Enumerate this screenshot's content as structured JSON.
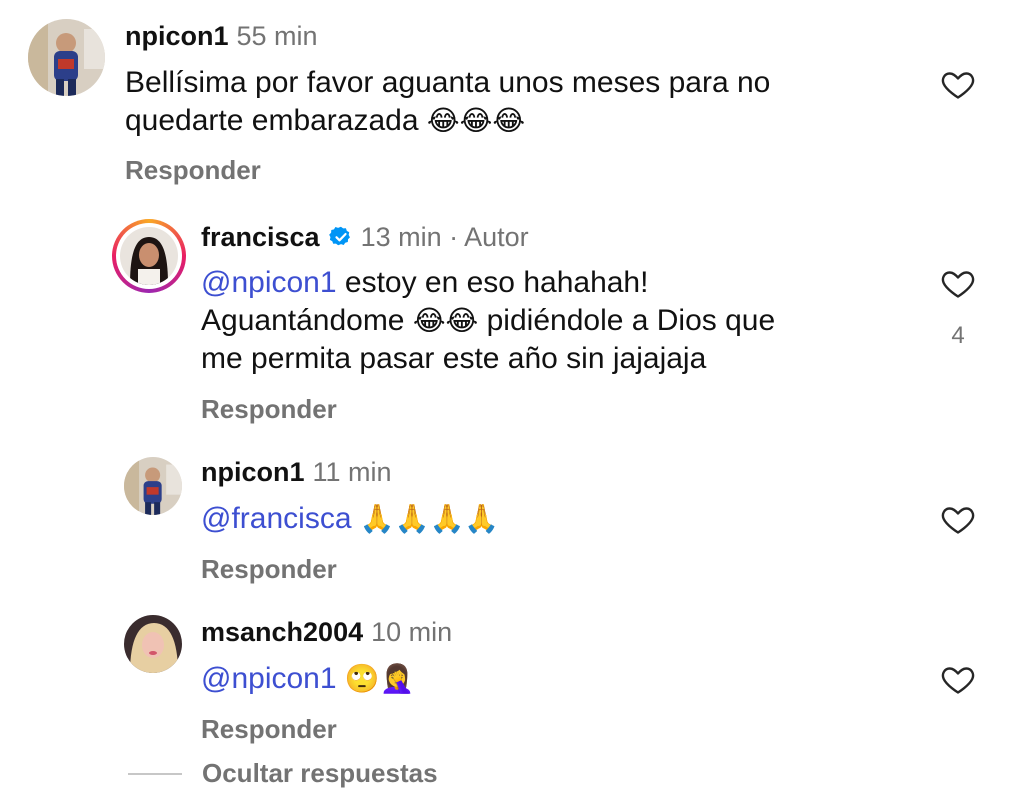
{
  "comments": [
    {
      "username": "npicon1",
      "time": "55 min",
      "text_line1": "Bellísima por favor aguanta unos meses para no",
      "text_line2": "quedarte embarazada",
      "emojis": "😂😂😂",
      "reply_label": "Responder"
    },
    {
      "username": "francisca",
      "time": "13 min · Autor",
      "mention": "@npicon1",
      "text_line1": " estoy en eso hahahah!",
      "text_line2_a": "Aguantándome",
      "emojis": "😂😂",
      "text_line2_b": "pidiéndole a Dios que",
      "text_line3": "me permita pasar este año sin jajajaja",
      "likes": "4",
      "reply_label": "Responder"
    },
    {
      "username": "npicon1",
      "time": "11 min",
      "mention": "@francisca",
      "emojis": "🙏🙏🙏🙏",
      "reply_label": "Responder"
    },
    {
      "username": "msanch2004",
      "time": "10 min",
      "mention": "@npicon1",
      "emojis": "🙄🤦‍♀️",
      "reply_label": "Responder"
    }
  ],
  "hide_replies_label": "Ocultar respuestas",
  "colors": {
    "mention": "#3d4fd1",
    "muted": "#737373",
    "verified": "#0095f6"
  }
}
